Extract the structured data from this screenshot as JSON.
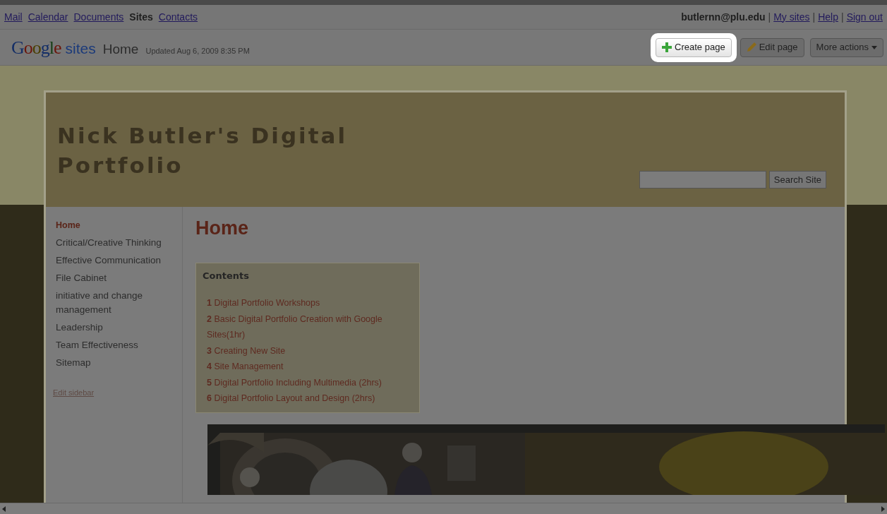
{
  "nav": {
    "apps": [
      {
        "label": "Mail",
        "selected": false
      },
      {
        "label": "Calendar",
        "selected": false
      },
      {
        "label": "Documents",
        "selected": false
      },
      {
        "label": "Sites",
        "selected": true
      },
      {
        "label": "Contacts",
        "selected": false
      }
    ],
    "user": "butlernn@plu.edu",
    "separator": "|",
    "links": [
      "My sites",
      "Help",
      "Sign out"
    ]
  },
  "toolbar": {
    "logo": {
      "google": "Google",
      "product": "sites"
    },
    "page_title": "Home",
    "updated": "Updated Aug 6, 2009 8:35 PM",
    "buttons": [
      {
        "label": "Create page",
        "kind": "create",
        "highlighted": true
      },
      {
        "label": "Edit page",
        "kind": "edit",
        "highlighted": false
      },
      {
        "label": "More actions",
        "kind": "menu",
        "highlighted": false
      }
    ]
  },
  "site": {
    "title": "Nick Butler's Digital Portfolio",
    "search_button": "Search Site"
  },
  "sidebar": {
    "items": [
      {
        "label": "Home",
        "selected": true
      },
      {
        "label": "Critical/Creative Thinking",
        "selected": false
      },
      {
        "label": "Effective Communication",
        "selected": false
      },
      {
        "label": "File Cabinet",
        "selected": false
      },
      {
        "label": "initiative and change management",
        "selected": false
      },
      {
        "label": "Leadership",
        "selected": false
      },
      {
        "label": "Team Effectiveness",
        "selected": false
      },
      {
        "label": "Sitemap",
        "selected": false
      }
    ],
    "edit_link": "Edit sidebar"
  },
  "content": {
    "heading": "Home",
    "toc": {
      "title": "Contents",
      "items": [
        {
          "number": "1",
          "label": "Digital Portfolio Workshops"
        },
        {
          "number": "2",
          "label": "Basic Digital Portfolio Creation with Google Sites(1hr)"
        },
        {
          "number": "3",
          "label": "Creating New Site"
        },
        {
          "number": "4",
          "label": "Site Management"
        },
        {
          "number": "5",
          "label": "Digital Portfolio Including Multimedia (2hrs)"
        },
        {
          "number": "6",
          "label": "Digital Portfolio Layout and Design (2hrs)"
        }
      ]
    }
  }
}
